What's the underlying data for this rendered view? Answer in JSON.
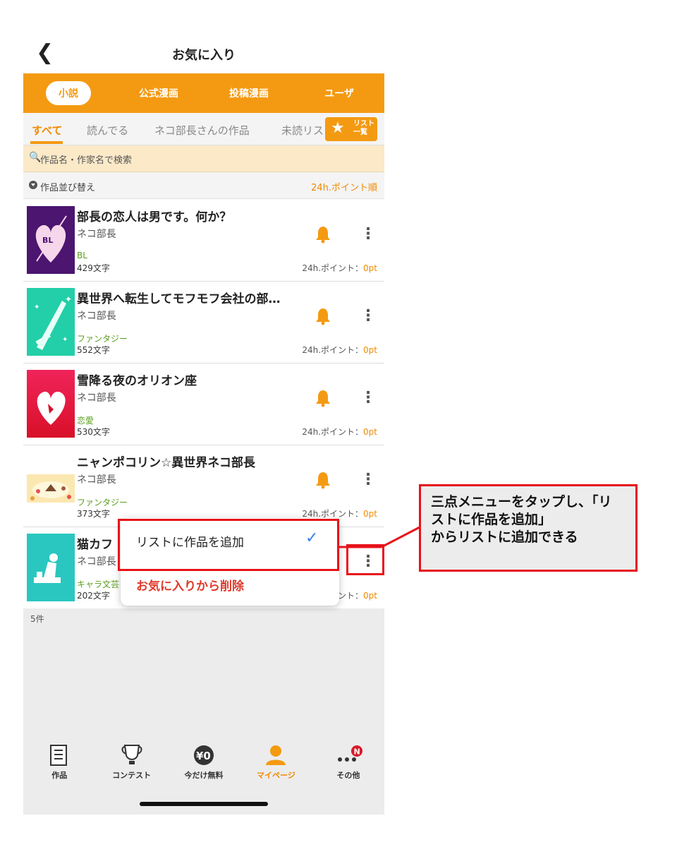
{
  "header": {
    "back_icon": "chevron-left-icon",
    "title": "お気に入り"
  },
  "categories": [
    {
      "label": "小説",
      "active": true
    },
    {
      "label": "公式漫画",
      "active": false
    },
    {
      "label": "投稿漫画",
      "active": false
    },
    {
      "label": "ユーザ",
      "active": false
    }
  ],
  "subtabs": [
    {
      "label": "すべて",
      "active": true
    },
    {
      "label": "読んでる",
      "active": false
    },
    {
      "label": "ネコ部長さんの作品",
      "active": false
    },
    {
      "label": "未読リス",
      "active": false
    }
  ],
  "list_button": {
    "line1": "リスト",
    "line2": "一覧",
    "icon": "star-list-icon"
  },
  "search": {
    "placeholder": "作品名・作家名で検索",
    "icon": "search-icon"
  },
  "sort": {
    "label": "作品並び替え",
    "value": "24h.ポイント順"
  },
  "items": [
    {
      "title": "部長の恋人は男です。何か？",
      "author": "ネコ部長",
      "genre": "BL",
      "chars": "429文字",
      "points_label": "24h.ポイント：",
      "points": "0pt"
    },
    {
      "title": "異世界へ転生してモフモフ会社の部…",
      "author": "ネコ部長",
      "genre": "ファンタジー",
      "chars": "552文字",
      "points_label": "24h.ポイント：",
      "points": "0pt"
    },
    {
      "title": "雪降る夜のオリオン座",
      "author": "ネコ部長",
      "genre": "恋愛",
      "chars": "530文字",
      "points_label": "24h.ポイント：",
      "points": "0pt"
    },
    {
      "title": "ニャンポコリン☆異世界ネコ部長",
      "author": "ネコ部長",
      "genre": "ファンタジー",
      "chars": "373文字",
      "points_label": "24h.ポイント：",
      "points": "0pt"
    },
    {
      "title": "猫カフ",
      "author": "ネコ部長",
      "genre": "キャラ文芸",
      "chars": "202文字",
      "points_label": "ント：",
      "points": "0pt"
    }
  ],
  "count": "5件",
  "popup": {
    "add_label": "リストに作品を追加",
    "delete_label": "お気に入りから削除"
  },
  "callout": {
    "line1": "三点メニューをタップし、「リ",
    "line2": "ストに作品を追加」",
    "line3": "からリストに追加できる"
  },
  "nav": [
    {
      "label": "作品",
      "icon": "book-icon",
      "active": false
    },
    {
      "label": "コンテスト",
      "icon": "trophy-icon",
      "active": false
    },
    {
      "label": "今だけ無料",
      "icon": "yen-zero-icon",
      "active": false
    },
    {
      "label": "マイページ",
      "icon": "person-icon",
      "active": true
    },
    {
      "label": "その他",
      "icon": "more-dots-icon",
      "active": false,
      "badge": "N"
    }
  ],
  "colors": {
    "accent": "#f49a12",
    "highlight": "#e8121a",
    "genre": "#5a9e1e"
  }
}
